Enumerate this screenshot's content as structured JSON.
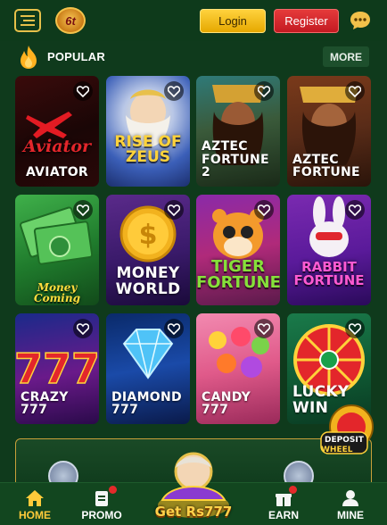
{
  "header": {
    "logo_text": "6t",
    "login_label": "Login",
    "register_label": "Register"
  },
  "section": {
    "title": "POPULAR",
    "more_label": "MORE"
  },
  "games": [
    {
      "name": "AVIATOR",
      "art_title": "Aviator"
    },
    {
      "name": "RISE OF ZEUS",
      "art_title": "RISE OF ZEUS"
    },
    {
      "name": "AZTEC FORTUNE 2"
    },
    {
      "name": "AZTEC FORTUNE"
    },
    {
      "name": "MONEY COMING",
      "art_title": "Money Coming"
    },
    {
      "name": "MONEY WORLD"
    },
    {
      "name": "TIGER FORTUNE"
    },
    {
      "name": "RABBIT FORTUNE"
    },
    {
      "name": "CRAZY 777"
    },
    {
      "name": "DIAMOND 777"
    },
    {
      "name": "CANDY 777"
    },
    {
      "name": "LUCKY WIN"
    }
  ],
  "floating": {
    "deposit_label": "DEPOSIT",
    "wheel_label": "WHEEL"
  },
  "bottom_nav": {
    "home": "HOME",
    "promo": "PROMO",
    "center_cta": "Get Rs777",
    "earn": "EARN",
    "mine": "MINE"
  },
  "colors": {
    "background": "#0f3a1c",
    "login": "#ffc72a",
    "register": "#d9262e",
    "active_nav": "#ffcb3a"
  }
}
